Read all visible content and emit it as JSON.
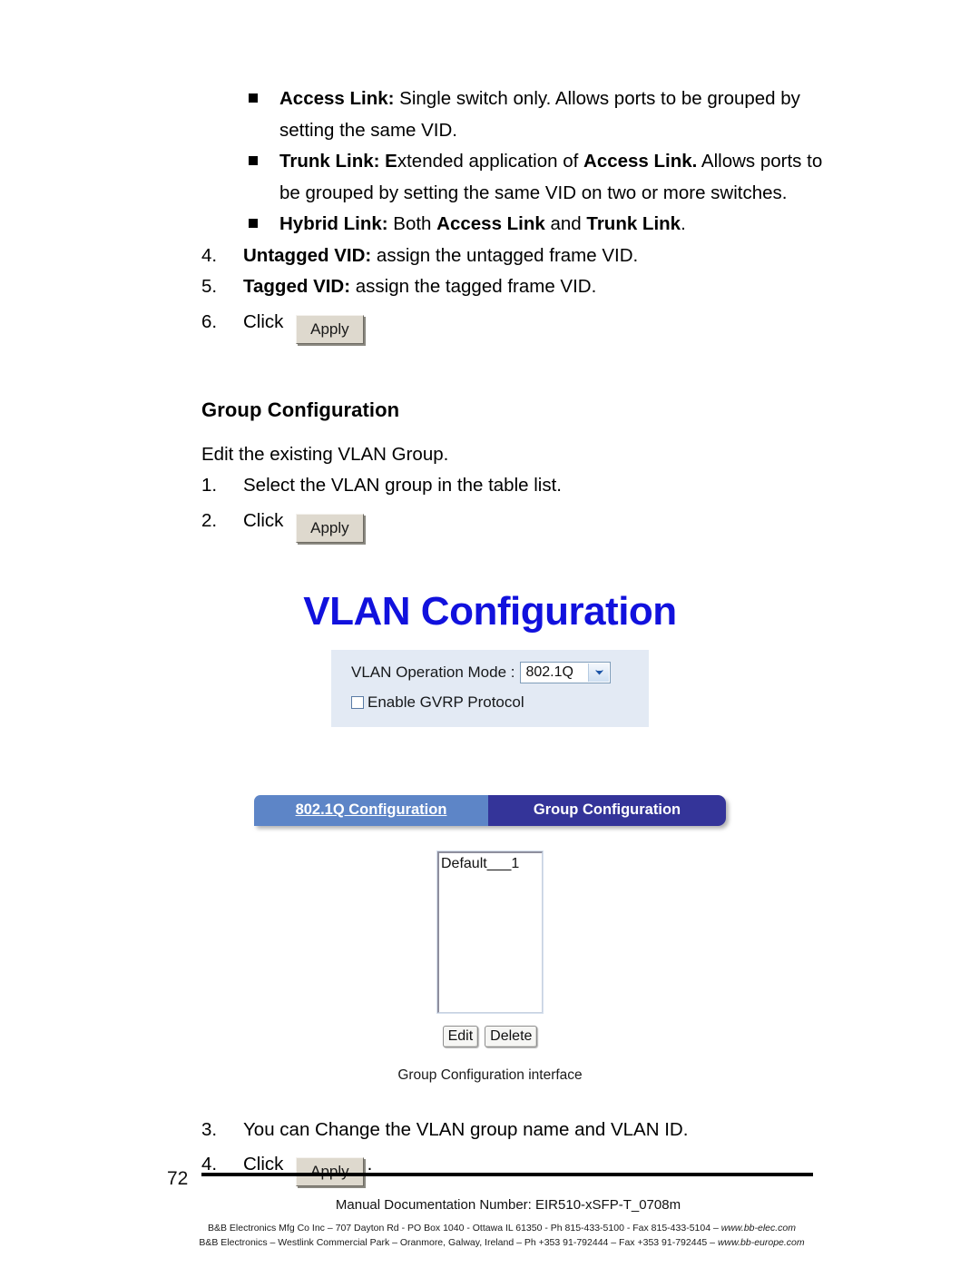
{
  "document": {
    "page_number": "72"
  },
  "bullets": [
    {
      "marker": "square-bullet",
      "strong": "Access Link:",
      "text": " Single switch only. Allows ports to be grouped by setting the same VID."
    },
    {
      "marker": "square-bullet",
      "strong": "Trunk Link: E",
      "text": "xtended application of ",
      "strong2": "Access Link.",
      "text2": " Allows ports to be grouped by setting the same VID on two or more switches."
    },
    {
      "marker": "square-bullet",
      "strong": "Hybrid Link:",
      "text": " Both ",
      "strong2": "Access Link",
      "text2": " and ",
      "strong3": "Trunk Link",
      "text3": "."
    }
  ],
  "steps_top": [
    {
      "number": "4.",
      "strong": "Untagged VID:",
      "text": " assign the untagged frame VID."
    },
    {
      "number": "5.",
      "strong": "Tagged VID:",
      "text": " assign the tagged frame VID."
    },
    {
      "number": "6.",
      "text": "Click ",
      "button": "Apply",
      "after": ""
    }
  ],
  "section": {
    "heading": "Group Configuration",
    "intro": "Edit the existing VLAN Group.",
    "steps": [
      {
        "number": "1.",
        "text": "Select the VLAN group in the table list."
      },
      {
        "number": "2.",
        "text": "Click ",
        "button": "Apply",
        "after": ""
      }
    ],
    "steps_after": [
      {
        "number": "3.",
        "text": "You can Change the VLAN group name and VLAN ID."
      },
      {
        "number": "4.",
        "text": "Click ",
        "button": "Apply",
        "after": "."
      }
    ]
  },
  "figure": {
    "title": "VLAN Configuration",
    "caption": "Group Configuration interface",
    "panel": {
      "mode_label": "VLAN Operation Mode :",
      "mode_value": "802.1Q",
      "gvrp_label": "Enable GVRP Protocol",
      "gvrp_checked": false,
      "background_color": "#e3eaf4"
    },
    "tabs": [
      {
        "label": "802.1Q Configuration",
        "active": false,
        "color": "#5d85c7"
      },
      {
        "label": "Group Configuration",
        "active": true,
        "color": "#343499"
      }
    ],
    "group_list": {
      "items": [
        "Default___1"
      ]
    },
    "list_buttons": [
      {
        "label": "Edit"
      },
      {
        "label": "Delete"
      }
    ],
    "title_color": "#1111dd"
  },
  "footer": {
    "doc_number": "Manual Documentation Number: EIR510-xSFP-T_0708m",
    "address_line_1_a": "B&B Electronics Mfg Co Inc – 707 Dayton Rd - PO Box 1040 - Ottawa IL 61350 - Ph 815-433-5100 - Fax 815-433-5104 – ",
    "address_line_1_url": "www.bb-elec.com",
    "address_line_2_a": "B&B Electronics – Westlink Commercial Park – Oranmore, Galway, Ireland – Ph +353 91-792444 – Fax +353 91-792445 – ",
    "address_line_2_url": "www.bb-europe.com"
  }
}
